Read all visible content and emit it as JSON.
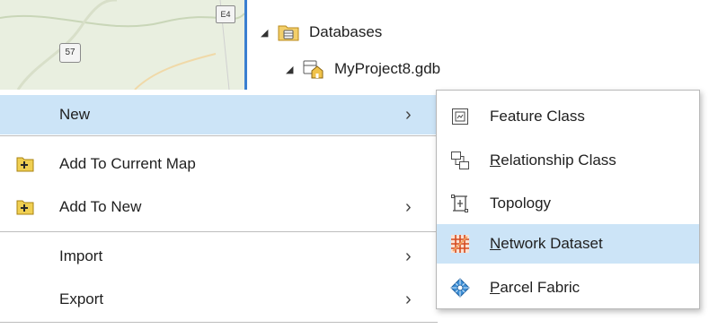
{
  "map_thumbnail": {
    "route_shield_1": "57",
    "route_shield_2": "E4"
  },
  "catalog_tree": {
    "databases_label": "Databases",
    "gdb_label": "MyProject8.gdb"
  },
  "context_menu": {
    "items": [
      {
        "label": "New",
        "icon": "none",
        "has_submenu": true,
        "highlighted": true
      },
      {
        "label": "Add To Current Map",
        "icon": "add-layer-icon",
        "has_submenu": false
      },
      {
        "label": "Add To New",
        "icon": "add-layer-icon",
        "has_submenu": true
      },
      {
        "label": "Import",
        "icon": "none",
        "has_submenu": true
      },
      {
        "label": "Export",
        "icon": "none",
        "has_submenu": true
      }
    ],
    "submenu_arrow": "›"
  },
  "new_submenu": {
    "items": [
      {
        "label": "Feature Class",
        "icon": "feature-class-icon"
      },
      {
        "label": "Relationship Class",
        "icon": "relationship-class-icon",
        "accelerator": "R"
      },
      {
        "label": "Topology",
        "icon": "topology-icon"
      },
      {
        "label": "Network Dataset",
        "icon": "network-dataset-icon",
        "accelerator": "N",
        "highlighted": true
      },
      {
        "label": "Parcel Fabric",
        "icon": "parcel-fabric-icon",
        "accelerator": "P"
      }
    ]
  },
  "colors": {
    "highlight": "#cce4f7",
    "accent_blue": "#3a7fd0",
    "folder_yellow": "#e8b83b"
  }
}
